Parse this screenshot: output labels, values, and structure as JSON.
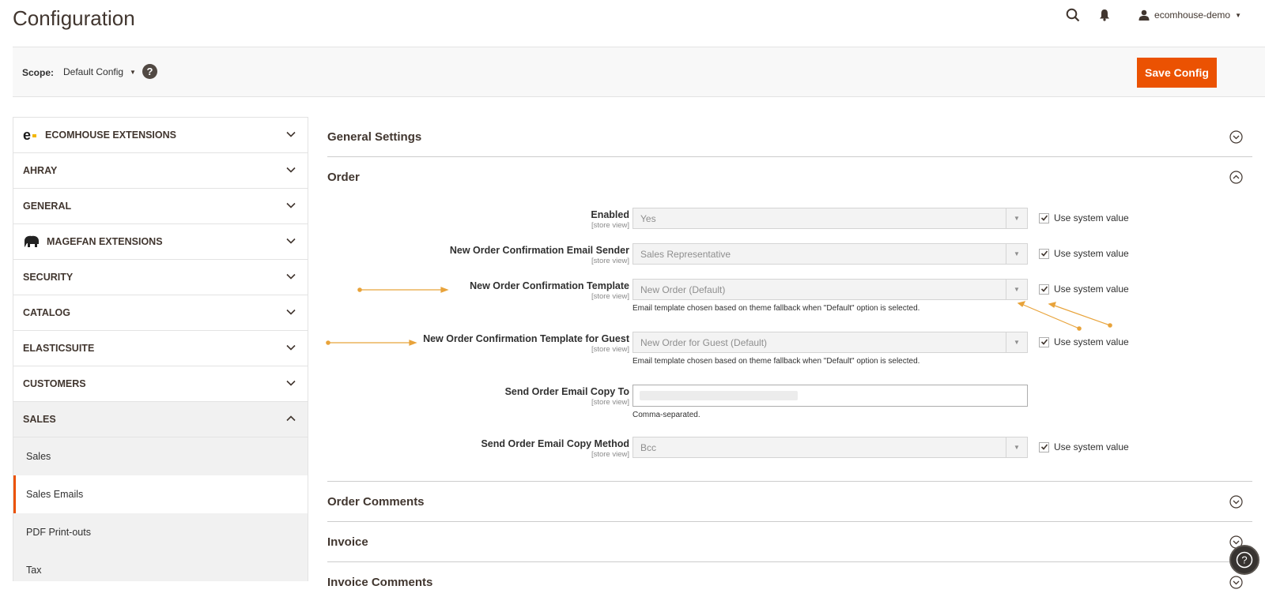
{
  "header": {
    "title": "Configuration",
    "search_icon": "search-icon",
    "notifications_icon": "bell-icon",
    "user_name": "ecomhouse-demo"
  },
  "scope": {
    "label": "Scope:",
    "value": "Default Config",
    "help": "?"
  },
  "save_button": "Save Config",
  "sidebar": {
    "sections": [
      {
        "label": "ECOMHOUSE EXTENSIONS",
        "icon": "ecomhouse-logo",
        "expanded": false
      },
      {
        "label": "AHRAY",
        "expanded": false
      },
      {
        "label": "GENERAL",
        "expanded": false
      },
      {
        "label": "MAGEFAN EXTENSIONS",
        "icon": "magefan-elephant-logo",
        "expanded": false
      },
      {
        "label": "SECURITY",
        "expanded": false
      },
      {
        "label": "CATALOG",
        "expanded": false
      },
      {
        "label": "ELASTICSUITE",
        "expanded": false
      },
      {
        "label": "CUSTOMERS",
        "expanded": false
      },
      {
        "label": "SALES",
        "expanded": true
      }
    ],
    "sales_items": [
      {
        "label": "Sales",
        "active": false
      },
      {
        "label": "Sales Emails",
        "active": true
      },
      {
        "label": "PDF Print-outs",
        "active": false
      },
      {
        "label": "Tax",
        "active": false
      }
    ]
  },
  "main": {
    "sections": {
      "general_settings": "General Settings",
      "order": "Order",
      "order_comments": "Order Comments",
      "invoice": "Invoice",
      "invoice_comments": "Invoice Comments"
    },
    "scope_hint": "[store view]",
    "use_system_value": "Use system value",
    "fields": {
      "enabled": {
        "label": "Enabled",
        "value": "Yes",
        "use_system": true
      },
      "sender": {
        "label": "New Order Confirmation Email Sender",
        "value": "Sales Representative",
        "use_system": true
      },
      "template": {
        "label": "New Order Confirmation Template",
        "value": "New Order (Default)",
        "use_system": true,
        "note": "Email template chosen based on theme fallback when \"Default\" option is selected."
      },
      "guest_template": {
        "label": "New Order Confirmation Template for Guest",
        "value": "New Order for Guest (Default)",
        "use_system": true,
        "note": "Email template chosen based on theme fallback when \"Default\" option is selected."
      },
      "copy_to": {
        "label": "Send Order Email Copy To",
        "value": "",
        "note": "Comma-separated."
      },
      "copy_method": {
        "label": "Send Order Email Copy Method",
        "value": "Bcc",
        "use_system": true
      }
    }
  },
  "colors": {
    "accent": "#eb5202",
    "annotation": "#e8a33a"
  }
}
